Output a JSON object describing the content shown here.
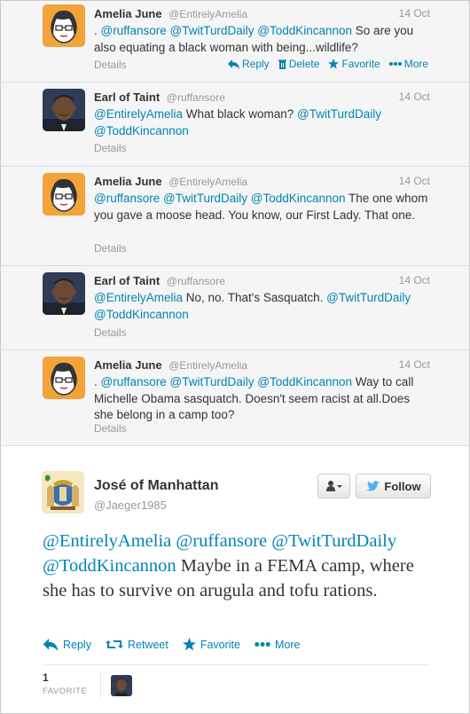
{
  "replies": [
    {
      "name": "Amelia June",
      "handle": "@EntirelyAmelia",
      "time": "14 Oct",
      "text_parts": [
        ". ",
        "@ruffansore",
        " ",
        "@TwitTurdDaily",
        " ",
        "@ToddKincannon",
        " So are you also equating a black woman with being...wildlife?"
      ],
      "details": "Details",
      "actions": {
        "reply": "Reply",
        "delete": "Delete",
        "favorite": "Favorite",
        "more": "More"
      }
    },
    {
      "name": "Earl of Taint",
      "handle": "@ruffansore",
      "time": "14 Oct",
      "text_parts": [
        "@EntirelyAmelia",
        " What black woman? ",
        "@TwitTurdDaily",
        " ",
        "@ToddKincannon",
        "",
        ""
      ],
      "details": "Details"
    },
    {
      "name": "Amelia June",
      "handle": "@EntirelyAmelia",
      "time": "14 Oct",
      "text_parts": [
        "@ruffansore",
        " ",
        "@TwitTurdDaily",
        " ",
        "@ToddKincannon",
        " The one whom you gave a moose head. You know, our First Lady. That one.",
        ""
      ],
      "details": "Details"
    },
    {
      "name": "Earl of Taint",
      "handle": "@ruffansore",
      "time": "14 Oct",
      "text_parts": [
        "@EntirelyAmelia",
        " No, no. That's Sasquatch. ",
        "@TwitTurdDaily",
        " ",
        "@ToddKincannon",
        "",
        ""
      ],
      "details": "Details"
    },
    {
      "name": "Amelia June",
      "handle": "@EntirelyAmelia",
      "time": "14 Oct",
      "text_parts": [
        ". ",
        "@ruffansore",
        " ",
        "@TwitTurdDaily",
        " ",
        "@ToddKincannon",
        " Way to call Michelle Obama sasquatch. Doesn't seem racist at all.Does she belong in a camp too?"
      ],
      "details": "Details"
    }
  ],
  "focus": {
    "name": "José of Manhattan",
    "handle": "@Jaeger1985",
    "follow_label": "Follow",
    "mentions": [
      "@EntirelyAmelia",
      "@ruffansore",
      "@TwitTurdDaily",
      "@ToddKincannon"
    ],
    "text": " Maybe in a FEMA camp, where she has to survive on arugula and tofu rations.",
    "actions": {
      "reply": "Reply",
      "retweet": "Retweet",
      "favorite": "Favorite",
      "more": "More"
    },
    "favorite_count": "1",
    "favorite_label": "FAVORITE"
  },
  "colors": {
    "link": "#0084b4",
    "muted": "#999999",
    "text": "#333333",
    "reply_bg": "#f5f5f5"
  }
}
